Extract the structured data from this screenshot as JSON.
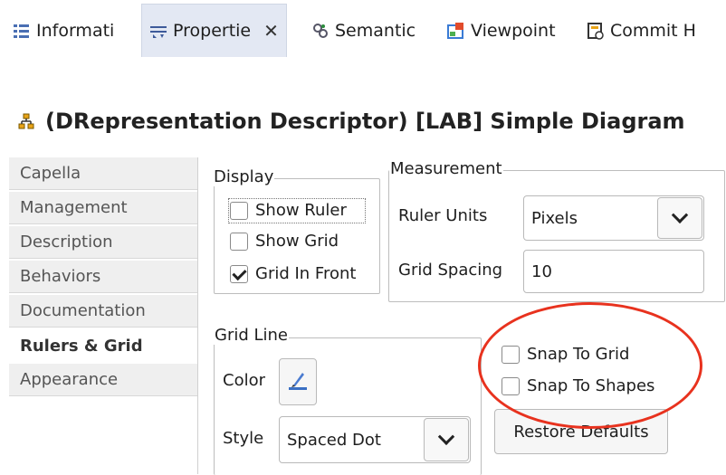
{
  "tabs": [
    {
      "label": "Informati",
      "icon": "information-icon"
    },
    {
      "label": "Propertie",
      "icon": "properties-icon",
      "active": true
    },
    {
      "label": "Semantic",
      "icon": "semantic-browser-icon"
    },
    {
      "label": "Viewpoint",
      "icon": "viewpoint-icon"
    },
    {
      "label": "Commit H",
      "icon": "commit-history-icon"
    }
  ],
  "close_glyph": "✕",
  "title": "(DRepresentation Descriptor)  [LAB] Simple Diagram",
  "sidebar": {
    "items": [
      {
        "label": "Capella"
      },
      {
        "label": "Management"
      },
      {
        "label": "Description"
      },
      {
        "label": "Behaviors"
      },
      {
        "label": "Documentation"
      },
      {
        "label": "Rulers & Grid",
        "active": true
      },
      {
        "label": "Appearance"
      }
    ]
  },
  "display": {
    "legend": "Display",
    "show_ruler": {
      "label": "Show Ruler",
      "checked": false
    },
    "show_grid": {
      "label": "Show Grid",
      "checked": false
    },
    "grid_in_front": {
      "label": "Grid In Front",
      "checked": true
    }
  },
  "measurement": {
    "legend": "Measurement",
    "ruler_units_label": "Ruler Units",
    "ruler_units_value": "Pixels",
    "grid_spacing_label": "Grid Spacing",
    "grid_spacing_value": "10"
  },
  "grid_line": {
    "legend": "Grid Line",
    "color_label": "Color",
    "style_label": "Style",
    "style_value": "Spaced Dot"
  },
  "snap": {
    "snap_to_grid": {
      "label": "Snap To Grid",
      "checked": false
    },
    "snap_to_shapes": {
      "label": "Snap To Shapes",
      "checked": false
    }
  },
  "restore_defaults_label": "Restore Defaults",
  "colors": {
    "highlight": "#e8321e",
    "active_tab": "#e3e8f3"
  }
}
